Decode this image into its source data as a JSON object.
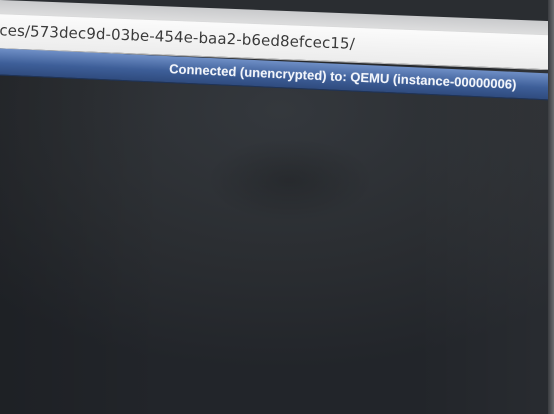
{
  "browser": {
    "url": "ces/573dec9d-03be-454e-baa2-b6ed8efcec15/"
  },
  "vnc": {
    "status_text": "Connected (unencrypted) to: QEMU (instance-00000006)",
    "status_bar_color": "#3e5f99",
    "console_bg_color": "#2a2d31"
  }
}
